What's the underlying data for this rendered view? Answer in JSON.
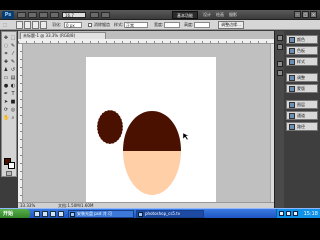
{
  "app": {
    "logo": "Ps",
    "zoom": "16.7",
    "workspace": "基本功能",
    "workspace_links": [
      "设计",
      "绘画",
      "摄影"
    ],
    "window_controls": [
      "–",
      "□",
      "×"
    ]
  },
  "options_bar": {
    "feather_label": "羽化:",
    "feather_value": "0 px",
    "antialias_label": "消除锯齿",
    "style_label": "样式:",
    "style_value": "正常",
    "width_label": "宽度:",
    "height_label": "高度:",
    "refine_edge": "调整边缘..."
  },
  "document": {
    "tab_title": "未标题-1 @ 33.3% (RGB/8)",
    "status_zoom": "33.33%",
    "status_info": "文档:1.50M/1.60M"
  },
  "colors": {
    "foreground": "#4a1000",
    "background": "#ffffff",
    "hair": "#4a1000",
    "skin": "#ffcfa8"
  },
  "panels": [
    {
      "label": "颜色",
      "icon": "color-icon"
    },
    {
      "label": "色板",
      "icon": "swatches-icon"
    },
    {
      "label": "样式",
      "icon": "styles-icon"
    },
    {
      "label": "调整",
      "icon": "adjustments-icon"
    },
    {
      "label": "蒙版",
      "icon": "masks-icon"
    },
    {
      "label": "图层",
      "icon": "layers-icon"
    },
    {
      "label": "通道",
      "icon": "channels-icon"
    },
    {
      "label": "路径",
      "icon": "paths-icon"
    }
  ],
  "taskbar": {
    "start_label": "开始",
    "tasks": [
      {
        "label": "安装光盘 psd 冷 可"
      },
      {
        "label": "photoshop_cs5.tv"
      }
    ],
    "clock": "15:18"
  }
}
